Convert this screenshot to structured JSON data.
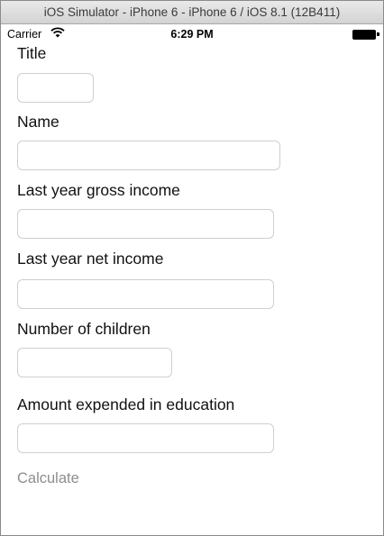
{
  "window": {
    "title": "iOS Simulator - iPhone 6 - iPhone 6 / iOS 8.1 (12B411)"
  },
  "status_bar": {
    "carrier": "Carrier",
    "time": "6:29 PM",
    "wifi_icon": "wifi-icon",
    "battery_icon": "battery-icon"
  },
  "form": {
    "title_label": "Title",
    "title_value": "",
    "name_label": "Name",
    "name_value": "",
    "gross_income_label": "Last year gross income",
    "gross_income_value": "",
    "net_income_label": "Last year net income",
    "net_income_value": "",
    "children_label": "Number of children",
    "children_value": "",
    "education_label": "Amount expended in education",
    "education_value": "",
    "calculate_label": "Calculate"
  },
  "colors": {
    "calculate_text": "#8d8d92",
    "field_border": "#cfcfcf"
  }
}
